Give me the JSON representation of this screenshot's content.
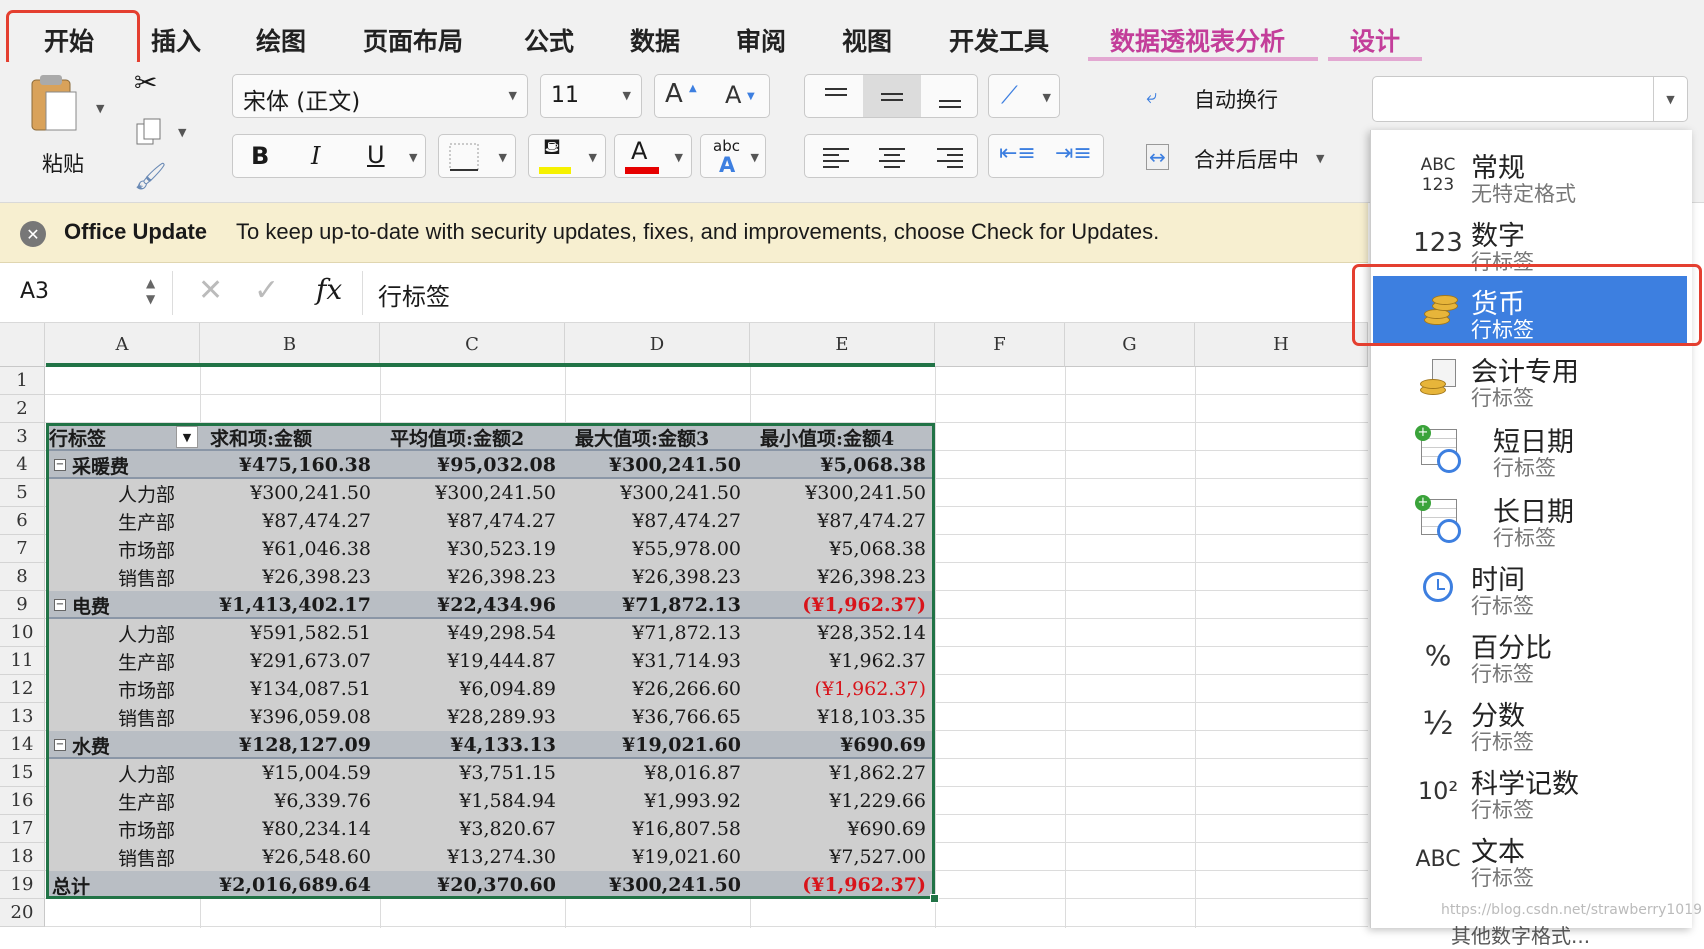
{
  "tabs": [
    "开始",
    "插入",
    "绘图",
    "页面布局",
    "公式",
    "数据",
    "审阅",
    "视图",
    "开发工具",
    "数据透视表分析",
    "设计"
  ],
  "toolbar": {
    "paste_label": "粘贴",
    "font_name": "宋体 (正文)",
    "font_size": "11",
    "grow_font": "A",
    "shrink_font": "A",
    "bold": "B",
    "italic": "I",
    "underline": "U",
    "font_color_glyph": "A",
    "abc_label": "abc",
    "wrap_text": "自动换行",
    "merge_center": "合并后居中",
    "number_format_value": ""
  },
  "update_bar": {
    "title": "Office Update",
    "message": "To keep up-to-date with security updates, fixes, and improvements, choose Check for Updates."
  },
  "formula_bar": {
    "name_box": "A3",
    "fx": "fx",
    "content": "行标签"
  },
  "columns": [
    "A",
    "B",
    "C",
    "D",
    "E",
    "F",
    "G",
    "H"
  ],
  "rows": [
    "1",
    "2",
    "3",
    "4",
    "5",
    "6",
    "7",
    "8",
    "9",
    "10",
    "11",
    "12",
    "13",
    "14",
    "15",
    "16",
    "17",
    "18",
    "19",
    "20"
  ],
  "pivot": {
    "headers": [
      "行标签",
      "求和项:金额",
      "平均值项:金额2",
      "最大值项:金额3",
      "最小值项:金额4"
    ],
    "rows": [
      {
        "label": "采暖费",
        "level": 0,
        "values": [
          "¥475,160.38",
          "¥95,032.08",
          "¥300,241.50",
          "¥5,068.38"
        ],
        "neg": [
          false,
          false,
          false,
          false
        ]
      },
      {
        "label": "人力部",
        "level": 1,
        "values": [
          "¥300,241.50",
          "¥300,241.50",
          "¥300,241.50",
          "¥300,241.50"
        ],
        "neg": [
          false,
          false,
          false,
          false
        ]
      },
      {
        "label": "生产部",
        "level": 1,
        "values": [
          "¥87,474.27",
          "¥87,474.27",
          "¥87,474.27",
          "¥87,474.27"
        ],
        "neg": [
          false,
          false,
          false,
          false
        ]
      },
      {
        "label": "市场部",
        "level": 1,
        "values": [
          "¥61,046.38",
          "¥30,523.19",
          "¥55,978.00",
          "¥5,068.38"
        ],
        "neg": [
          false,
          false,
          false,
          false
        ]
      },
      {
        "label": "销售部",
        "level": 1,
        "values": [
          "¥26,398.23",
          "¥26,398.23",
          "¥26,398.23",
          "¥26,398.23"
        ],
        "neg": [
          false,
          false,
          false,
          false
        ]
      },
      {
        "label": "电费",
        "level": 0,
        "values": [
          "¥1,413,402.17",
          "¥22,434.96",
          "¥71,872.13",
          "(¥1,962.37)"
        ],
        "neg": [
          false,
          false,
          false,
          true
        ]
      },
      {
        "label": "人力部",
        "level": 1,
        "values": [
          "¥591,582.51",
          "¥49,298.54",
          "¥71,872.13",
          "¥28,352.14"
        ],
        "neg": [
          false,
          false,
          false,
          false
        ]
      },
      {
        "label": "生产部",
        "level": 1,
        "values": [
          "¥291,673.07",
          "¥19,444.87",
          "¥31,714.93",
          "¥1,962.37"
        ],
        "neg": [
          false,
          false,
          false,
          false
        ]
      },
      {
        "label": "市场部",
        "level": 1,
        "values": [
          "¥134,087.51",
          "¥6,094.89",
          "¥26,266.60",
          "(¥1,962.37)"
        ],
        "neg": [
          false,
          false,
          false,
          true
        ]
      },
      {
        "label": "销售部",
        "level": 1,
        "values": [
          "¥396,059.08",
          "¥28,289.93",
          "¥36,766.65",
          "¥18,103.35"
        ],
        "neg": [
          false,
          false,
          false,
          false
        ]
      },
      {
        "label": "水费",
        "level": 0,
        "values": [
          "¥128,127.09",
          "¥4,133.13",
          "¥19,021.60",
          "¥690.69"
        ],
        "neg": [
          false,
          false,
          false,
          false
        ]
      },
      {
        "label": "人力部",
        "level": 1,
        "values": [
          "¥15,004.59",
          "¥3,751.15",
          "¥8,016.87",
          "¥1,862.27"
        ],
        "neg": [
          false,
          false,
          false,
          false
        ]
      },
      {
        "label": "生产部",
        "level": 1,
        "values": [
          "¥6,339.76",
          "¥1,584.94",
          "¥1,993.92",
          "¥1,229.66"
        ],
        "neg": [
          false,
          false,
          false,
          false
        ]
      },
      {
        "label": "市场部",
        "level": 1,
        "values": [
          "¥80,234.14",
          "¥3,820.67",
          "¥16,807.58",
          "¥690.69"
        ],
        "neg": [
          false,
          false,
          false,
          false
        ]
      },
      {
        "label": "销售部",
        "level": 1,
        "values": [
          "¥26,548.60",
          "¥13,274.30",
          "¥19,021.60",
          "¥7,527.00"
        ],
        "neg": [
          false,
          false,
          false,
          false
        ]
      }
    ],
    "total": {
      "label": "总计",
      "values": [
        "¥2,016,689.64",
        "¥20,370.60",
        "¥300,241.50",
        "(¥1,962.37)"
      ],
      "neg": [
        false,
        false,
        false,
        true
      ]
    }
  },
  "formats": [
    {
      "icon": "general-icon",
      "title": "常规",
      "sub": "无特定格式"
    },
    {
      "icon": "number-icon",
      "title": "数字",
      "sub": "行标签"
    },
    {
      "icon": "currency-icon",
      "title": "货币",
      "sub": "行标签"
    },
    {
      "icon": "accounting-icon",
      "title": "会计专用",
      "sub": "行标签"
    },
    {
      "icon": "short-date-icon",
      "title": "短日期",
      "sub": "行标签"
    },
    {
      "icon": "long-date-icon",
      "title": "长日期",
      "sub": "行标签"
    },
    {
      "icon": "time-icon",
      "title": "时间",
      "sub": "行标签"
    },
    {
      "icon": "percent-icon",
      "title": "百分比",
      "sub": "行标签"
    },
    {
      "icon": "fraction-icon",
      "title": "分数",
      "sub": "行标签"
    },
    {
      "icon": "scientific-icon",
      "title": "科学记数",
      "sub": "行标签"
    },
    {
      "icon": "text-icon",
      "title": "文本",
      "sub": "行标签"
    }
  ],
  "format_icon_text": {
    "general_top": "ABC",
    "general_bottom": "123",
    "number": "123",
    "percent": "%",
    "fraction": "½",
    "scientific": "10²",
    "text": "ABC"
  },
  "watermark": "https://blog.csdn.net/strawberry1019",
  "colors": {
    "selected": "#3d7fe0",
    "pivot_tab": "#c33e9a",
    "highlight_box": "#e43f30",
    "negative": "#d8141b"
  }
}
